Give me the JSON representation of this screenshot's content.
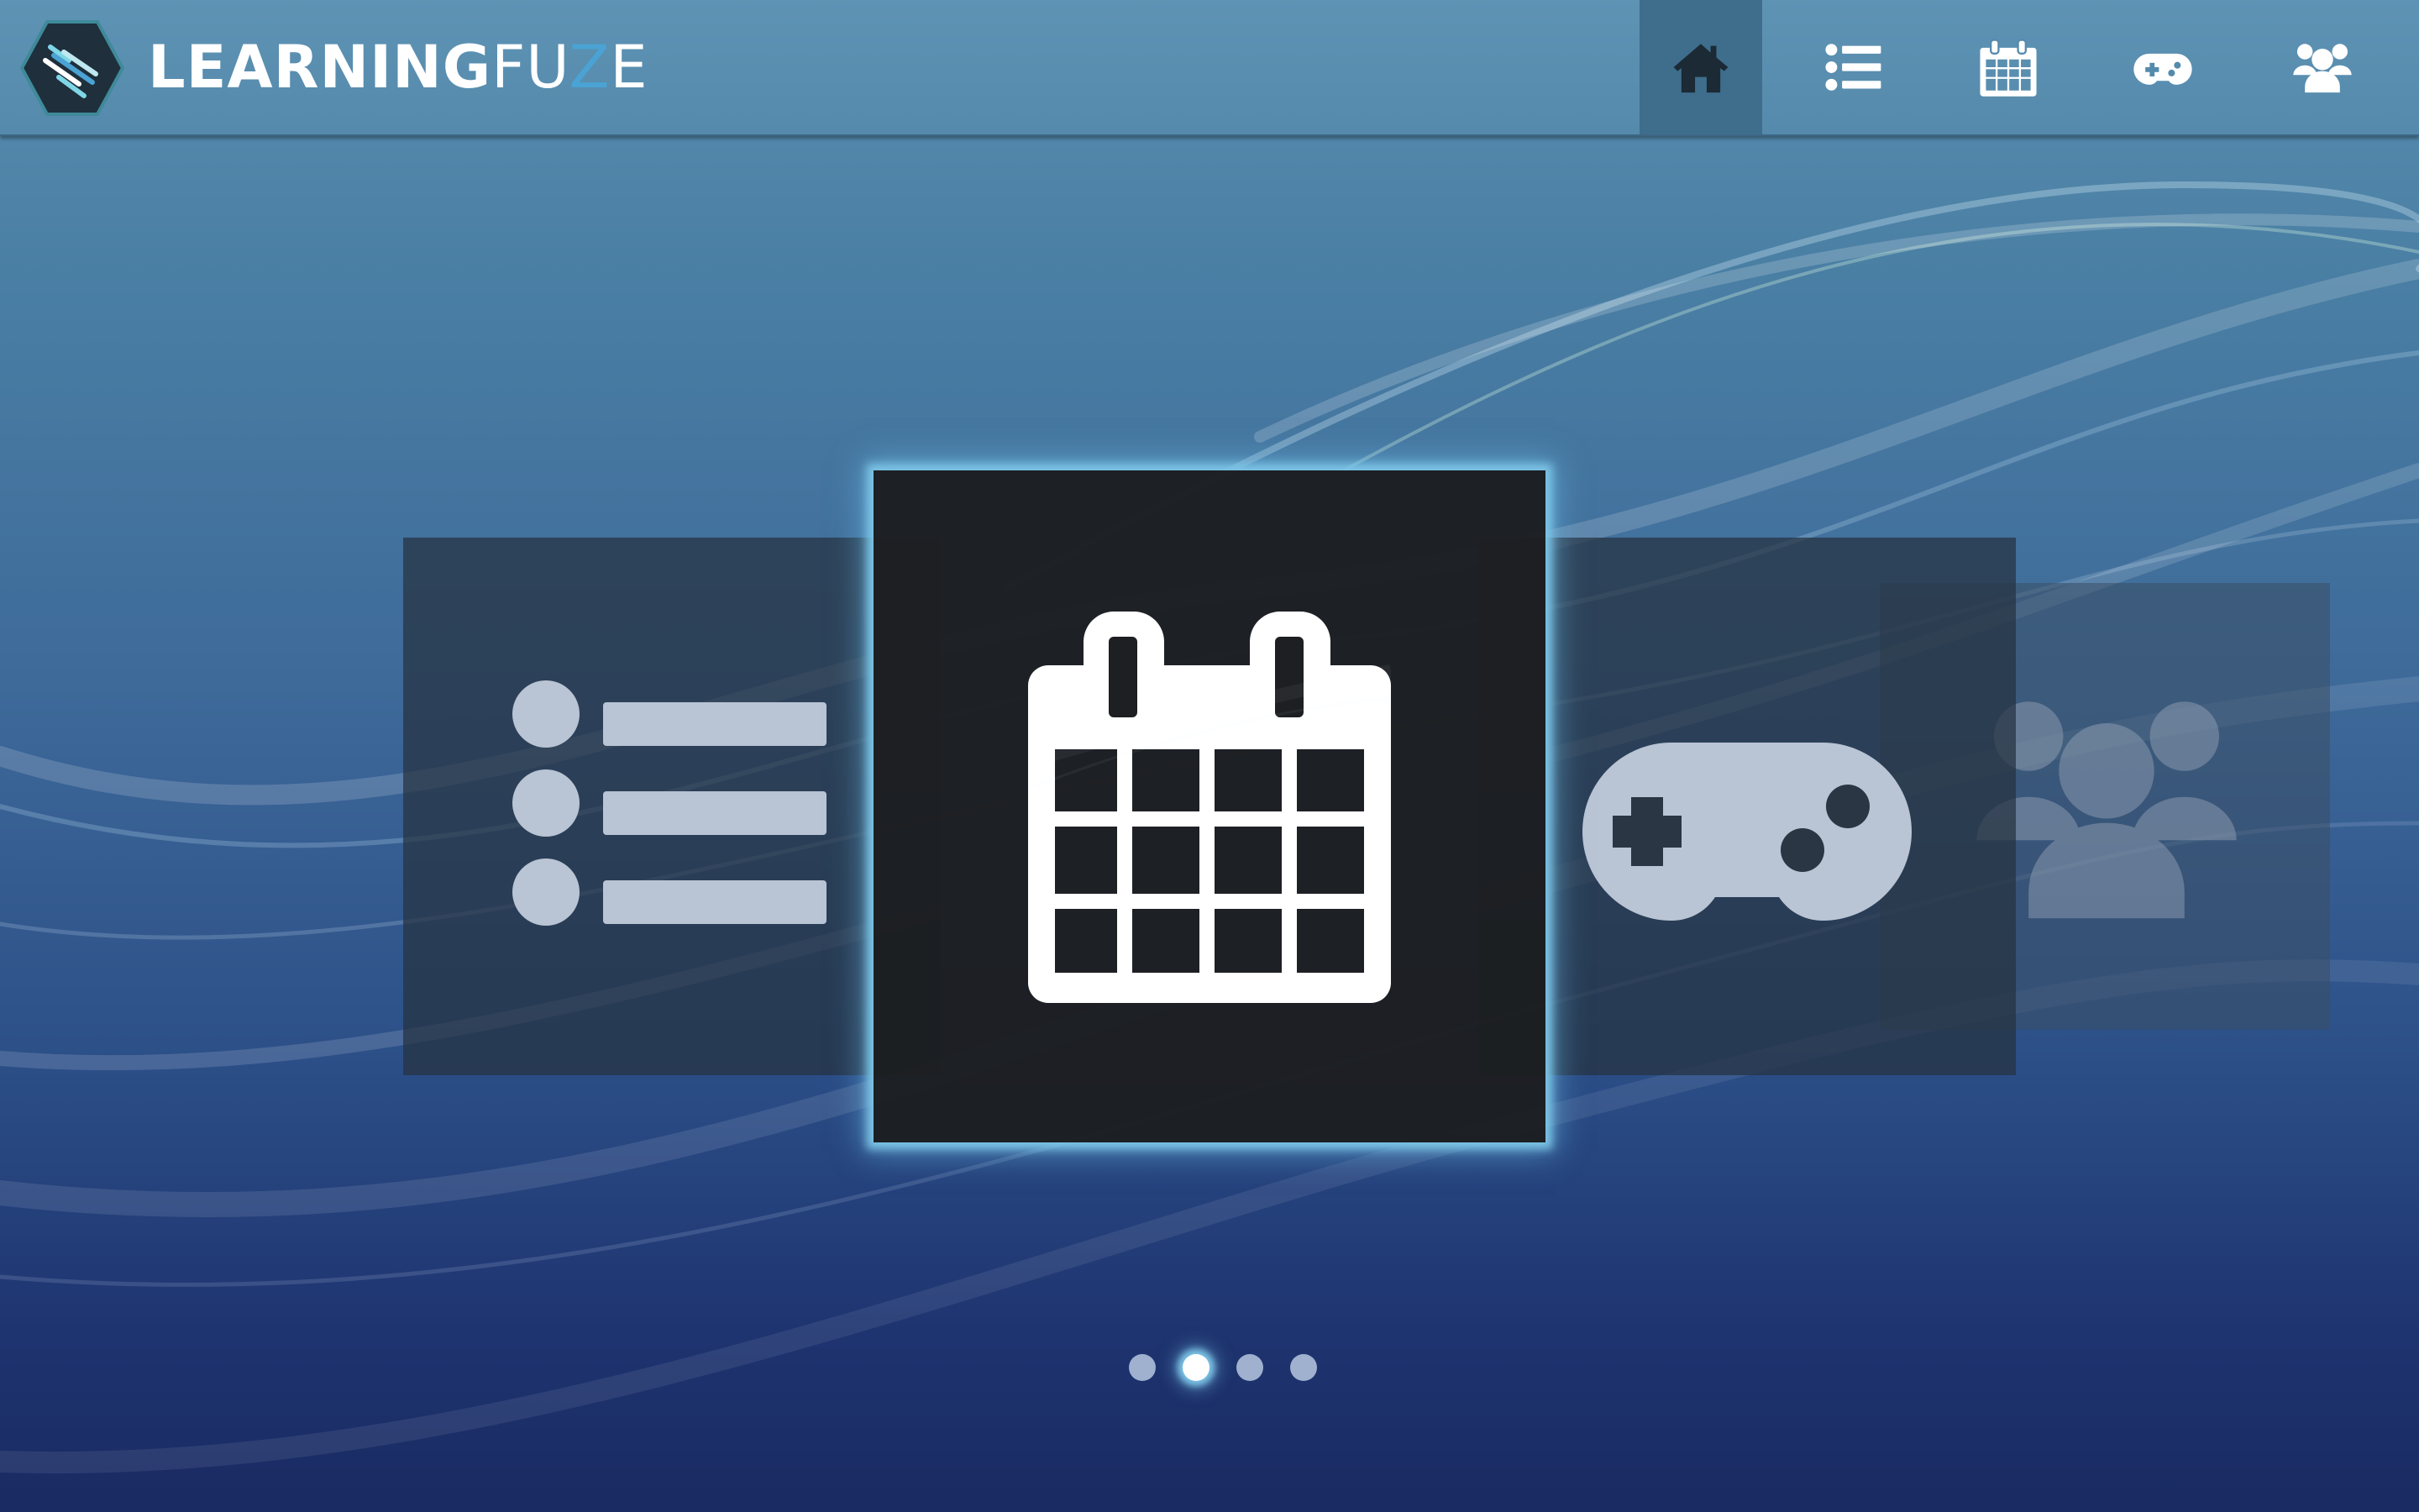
{
  "brand": {
    "name_bold": "LEARNING",
    "name_light_1": "FU",
    "name_accent": "Z",
    "name_light_2": "E"
  },
  "nav": {
    "items": [
      {
        "icon": "home-icon",
        "active": true
      },
      {
        "icon": "list-icon",
        "active": false
      },
      {
        "icon": "calendar-icon",
        "active": false
      },
      {
        "icon": "gamepad-icon",
        "active": false
      },
      {
        "icon": "users-icon",
        "active": false
      }
    ]
  },
  "carousel": {
    "cards": [
      {
        "icon": "list-icon",
        "selected": false
      },
      {
        "icon": "calendar-icon",
        "selected": true
      },
      {
        "icon": "gamepad-icon",
        "selected": false
      },
      {
        "icon": "users-icon",
        "selected": false
      }
    ],
    "page_count": 4,
    "active_page": 2
  },
  "colors": {
    "accent": "#4aa3d4",
    "glow": "#7cc4e6",
    "active_nav_bg": "#3f6d8c",
    "card_dark": "#1d1f22"
  }
}
